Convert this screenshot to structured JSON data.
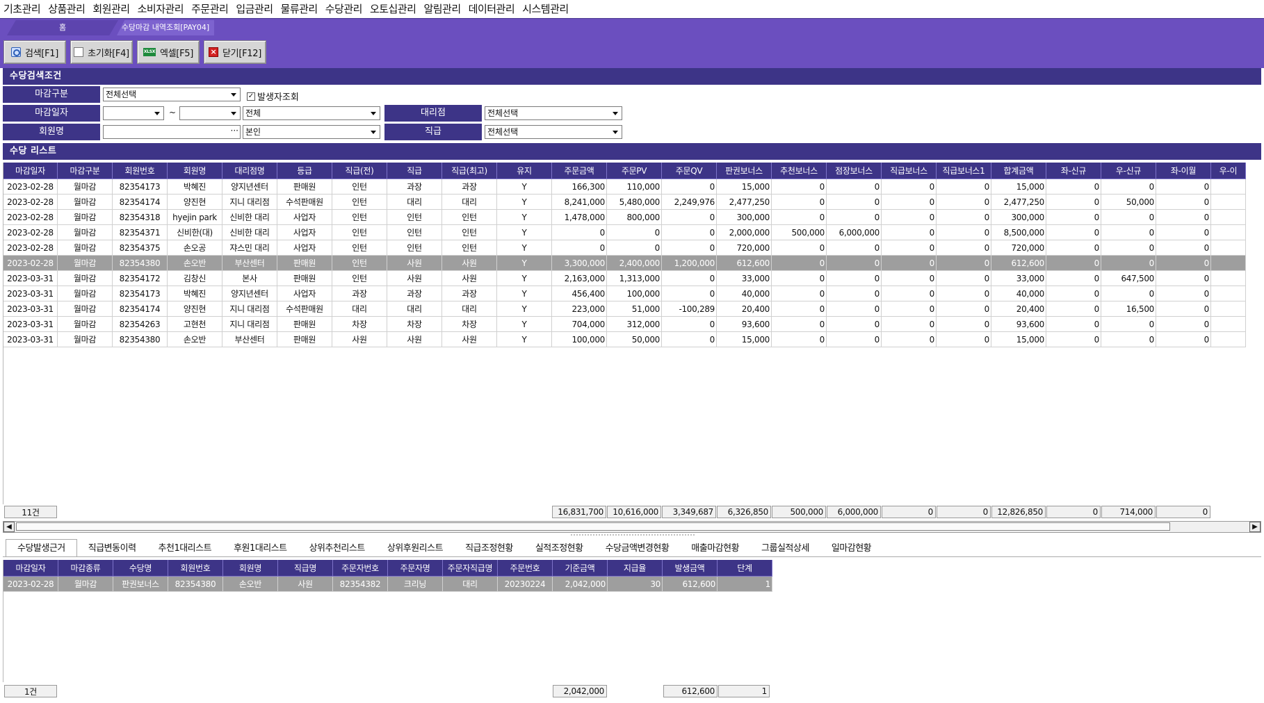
{
  "menu": [
    "기초관리",
    "상품관리",
    "회원관리",
    "소비자관리",
    "주문관리",
    "입금관리",
    "물류관리",
    "수당관리",
    "오토십관리",
    "알림관리",
    "데이터관리",
    "시스템관리"
  ],
  "doc_tabs": {
    "home": "홈",
    "current": "수당마감 내역조회[PAY04]"
  },
  "toolbar": {
    "search": "검색[F1]",
    "reset": "초기화[F4]",
    "excel": "엑셀[F5]",
    "close": "닫기[F12]",
    "excel_icon_text": "XLSX"
  },
  "search_section": {
    "title": "수당검색조건",
    "close_type_label": "마감구분",
    "close_type_value": "전체선택",
    "occurrence_check_label": "발생자조회",
    "close_date_label": "마감일자",
    "date_from": "",
    "date_to": "",
    "tilde": "~",
    "date_scope_value": "전체",
    "agency_label": "대리점",
    "agency_value": "전체선택",
    "member_name_label": "회원명",
    "member_name_value": "",
    "member_scope_value": "본인",
    "rank_label": "직급",
    "rank_value": "전체선택"
  },
  "list_section": {
    "title": "수당 리스트",
    "columns": [
      "마감일자",
      "마감구분",
      "회원번호",
      "회원명",
      "대리점명",
      "등급",
      "직급(전)",
      "직급",
      "직급(최고)",
      "유지",
      "주문금액",
      "주문PV",
      "주문QV",
      "판권보너스",
      "추천보너스",
      "점장보너스",
      "직급보너스",
      "직급보너스1",
      "합계금액",
      "좌-신규",
      "우-신규",
      "좌-이월",
      "우-이"
    ],
    "rows": [
      [
        "2023-02-28",
        "월마감",
        "82354173",
        "박혜진",
        "양지년센터",
        "판매원",
        "인턴",
        "과장",
        "과장",
        "Y",
        "166,300",
        "110,000",
        "0",
        "15,000",
        "0",
        "0",
        "0",
        "0",
        "15,000",
        "0",
        "0",
        "0",
        ""
      ],
      [
        "2023-02-28",
        "월마감",
        "82354174",
        "양진현",
        "지니 대리점",
        "수석판매원",
        "인턴",
        "대리",
        "대리",
        "Y",
        "8,241,000",
        "5,480,000",
        "2,249,976",
        "2,477,250",
        "0",
        "0",
        "0",
        "0",
        "2,477,250",
        "0",
        "50,000",
        "0",
        ""
      ],
      [
        "2023-02-28",
        "월마감",
        "82354318",
        "hyejin park",
        "신비한 대리",
        "사업자",
        "인턴",
        "인턴",
        "인턴",
        "Y",
        "1,478,000",
        "800,000",
        "0",
        "300,000",
        "0",
        "0",
        "0",
        "0",
        "300,000",
        "0",
        "0",
        "0",
        ""
      ],
      [
        "2023-02-28",
        "월마감",
        "82354371",
        "신비한(대)",
        "신비한 대리",
        "사업자",
        "인턴",
        "인턴",
        "인턴",
        "Y",
        "0",
        "0",
        "0",
        "2,000,000",
        "500,000",
        "6,000,000",
        "0",
        "0",
        "8,500,000",
        "0",
        "0",
        "0",
        ""
      ],
      [
        "2023-02-28",
        "월마감",
        "82354375",
        "손오공",
        "쟈스민 대리",
        "사업자",
        "인턴",
        "인턴",
        "인턴",
        "Y",
        "0",
        "0",
        "0",
        "720,000",
        "0",
        "0",
        "0",
        "0",
        "720,000",
        "0",
        "0",
        "0",
        ""
      ],
      [
        "2023-02-28",
        "월마감",
        "82354380",
        "손오반",
        "부산센터",
        "판매원",
        "인턴",
        "사원",
        "사원",
        "Y",
        "3,300,000",
        "2,400,000",
        "1,200,000",
        "612,600",
        "0",
        "0",
        "0",
        "0",
        "612,600",
        "0",
        "0",
        "0",
        ""
      ],
      [
        "2023-03-31",
        "월마감",
        "82354172",
        "김창신",
        "본사",
        "판매원",
        "인턴",
        "사원",
        "사원",
        "Y",
        "2,163,000",
        "1,313,000",
        "0",
        "33,000",
        "0",
        "0",
        "0",
        "0",
        "33,000",
        "0",
        "647,500",
        "0",
        ""
      ],
      [
        "2023-03-31",
        "월마감",
        "82354173",
        "박혜진",
        "양지년센터",
        "사업자",
        "과장",
        "과장",
        "과장",
        "Y",
        "456,400",
        "100,000",
        "0",
        "40,000",
        "0",
        "0",
        "0",
        "0",
        "40,000",
        "0",
        "0",
        "0",
        ""
      ],
      [
        "2023-03-31",
        "월마감",
        "82354174",
        "양진현",
        "지니 대리점",
        "수석판매원",
        "대리",
        "대리",
        "대리",
        "Y",
        "223,000",
        "51,000",
        "-100,289",
        "20,400",
        "0",
        "0",
        "0",
        "0",
        "20,400",
        "0",
        "16,500",
        "0",
        ""
      ],
      [
        "2023-03-31",
        "월마감",
        "82354263",
        "고현천",
        "지니 대리점",
        "판매원",
        "차장",
        "차장",
        "차장",
        "Y",
        "704,000",
        "312,000",
        "0",
        "93,600",
        "0",
        "0",
        "0",
        "0",
        "93,600",
        "0",
        "0",
        "0",
        ""
      ],
      [
        "2023-03-31",
        "월마감",
        "82354380",
        "손오반",
        "부산센터",
        "판매원",
        "사원",
        "사원",
        "사원",
        "Y",
        "100,000",
        "50,000",
        "0",
        "15,000",
        "0",
        "0",
        "0",
        "0",
        "15,000",
        "0",
        "0",
        "0",
        ""
      ]
    ],
    "selected_row": 5,
    "footer": {
      "count": "11건",
      "values": [
        "16,831,700",
        "10,616,000",
        "3,349,687",
        "6,326,850",
        "500,000",
        "6,000,000",
        "0",
        "0",
        "12,826,850",
        "0",
        "714,000",
        "0"
      ]
    }
  },
  "detail_tabs": [
    "수당발생근거",
    "직급변동이력",
    "추천1대리스트",
    "후원1대리스트",
    "상위추천리스트",
    "상위후원리스트",
    "직급조정현황",
    "실적조정현황",
    "수당금액변경현황",
    "매출마감현황",
    "그룹실적상세",
    "일마감현황"
  ],
  "detail_grid": {
    "columns": [
      "마감일자",
      "마감종류",
      "수당명",
      "회원번호",
      "회원명",
      "직급명",
      "주문자번호",
      "주문자명",
      "주문자직급명",
      "주문번호",
      "기준금액",
      "지급율",
      "발생금액",
      "단계"
    ],
    "rows": [
      [
        "2023-02-28",
        "월마감",
        "판권보너스",
        "82354380",
        "손오반",
        "사원",
        "82354382",
        "크리닝",
        "대리",
        "20230224",
        "2,042,000",
        "30",
        "612,600",
        "1"
      ]
    ],
    "footer": {
      "count": "1건",
      "base_amount": "2,042,000",
      "amount": "612,600",
      "step": "1"
    }
  },
  "scroll": {
    "left_arrow": "◀",
    "right_arrow": "▶"
  },
  "colors": {
    "menu_purple": "#6b4fbf",
    "header_navy": "#3d3487",
    "selected_row": "#9e9e9e"
  },
  "icons": [
    "search-icon",
    "reset-icon",
    "excel-icon",
    "close-icon",
    "dropdown-arrow-icon",
    "checkbox-icon"
  ]
}
